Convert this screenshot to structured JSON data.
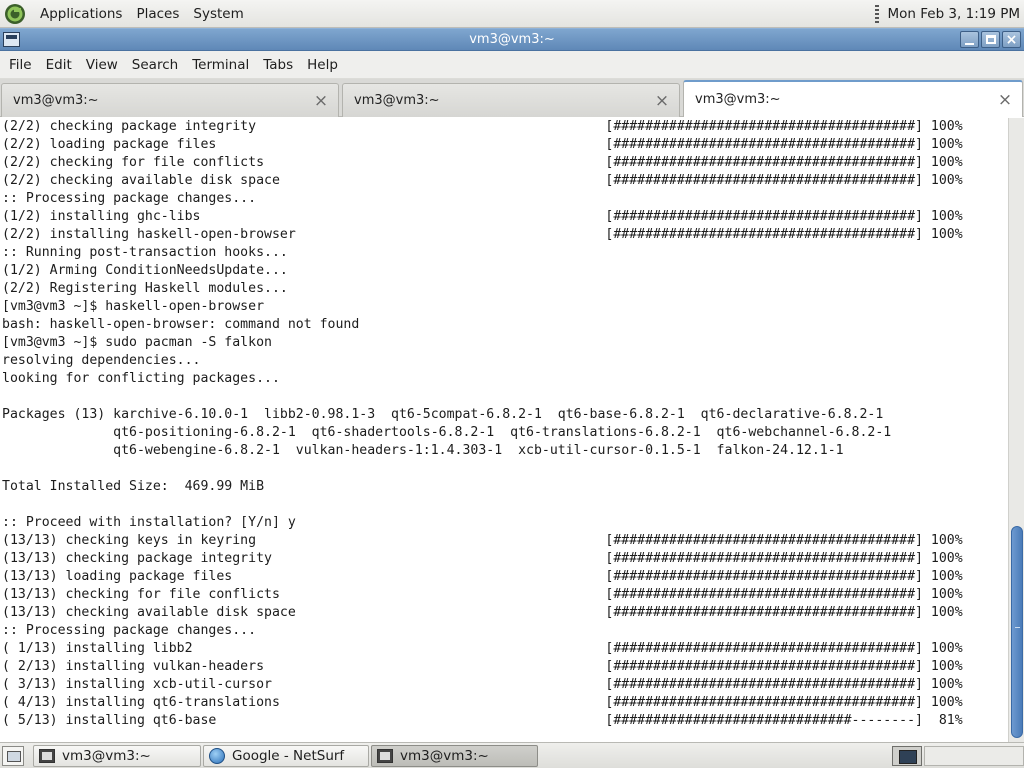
{
  "top_panel": {
    "menus": [
      "Applications",
      "Places",
      "System"
    ],
    "clock": "Mon Feb  3, 1:19 PM"
  },
  "window": {
    "title": "vm3@vm3:~",
    "buttons": {
      "close": "×"
    }
  },
  "menubar": [
    "File",
    "Edit",
    "View",
    "Search",
    "Terminal",
    "Tabs",
    "Help"
  ],
  "tabs": [
    {
      "label": "vm3@vm3:~",
      "close": "×",
      "active": false
    },
    {
      "label": "vm3@vm3:~",
      "close": "×",
      "active": false
    },
    {
      "label": "vm3@vm3:~",
      "close": "×",
      "active": true
    }
  ],
  "terminal": {
    "lines": [
      "(2/2) checking package integrity                                            [######################################] 100%",
      "(2/2) loading package files                                                 [######################################] 100%",
      "(2/2) checking for file conflicts                                           [######################################] 100%",
      "(2/2) checking available disk space                                         [######################################] 100%",
      ":: Processing package changes...",
      "(1/2) installing ghc-libs                                                   [######################################] 100%",
      "(2/2) installing haskell-open-browser                                       [######################################] 100%",
      ":: Running post-transaction hooks...",
      "(1/2) Arming ConditionNeedsUpdate...",
      "(2/2) Registering Haskell modules...",
      "[vm3@vm3 ~]$ haskell-open-browser",
      "bash: haskell-open-browser: command not found",
      "[vm3@vm3 ~]$ sudo pacman -S falkon",
      "resolving dependencies...",
      "looking for conflicting packages...",
      "",
      "Packages (13) karchive-6.10.0-1  libb2-0.98.1-3  qt6-5compat-6.8.2-1  qt6-base-6.8.2-1  qt6-declarative-6.8.2-1",
      "              qt6-positioning-6.8.2-1  qt6-shadertools-6.8.2-1  qt6-translations-6.8.2-1  qt6-webchannel-6.8.2-1",
      "              qt6-webengine-6.8.2-1  vulkan-headers-1:1.4.303-1  xcb-util-cursor-0.1.5-1  falkon-24.12.1-1",
      "",
      "Total Installed Size:  469.99 MiB",
      "",
      ":: Proceed with installation? [Y/n] y",
      "(13/13) checking keys in keyring                                            [######################################] 100%",
      "(13/13) checking package integrity                                          [######################################] 100%",
      "(13/13) loading package files                                               [######################################] 100%",
      "(13/13) checking for file conflicts                                         [######################################] 100%",
      "(13/13) checking available disk space                                       [######################################] 100%",
      ":: Processing package changes...",
      "( 1/13) installing libb2                                                    [######################################] 100%",
      "( 2/13) installing vulkan-headers                                           [######################################] 100%",
      "( 3/13) installing xcb-util-cursor                                          [######################################] 100%",
      "( 4/13) installing qt6-translations                                         [######################################] 100%",
      "( 5/13) installing qt6-base                                                 [##############################--------]  81%"
    ]
  },
  "taskbar": {
    "buttons": [
      {
        "label": "vm3@vm3:~",
        "icon": "terminal-icon",
        "active": false
      },
      {
        "label": "Google - NetSurf",
        "icon": "globe-icon",
        "active": false
      },
      {
        "label": "vm3@vm3:~",
        "icon": "terminal-icon",
        "active": true
      }
    ]
  }
}
